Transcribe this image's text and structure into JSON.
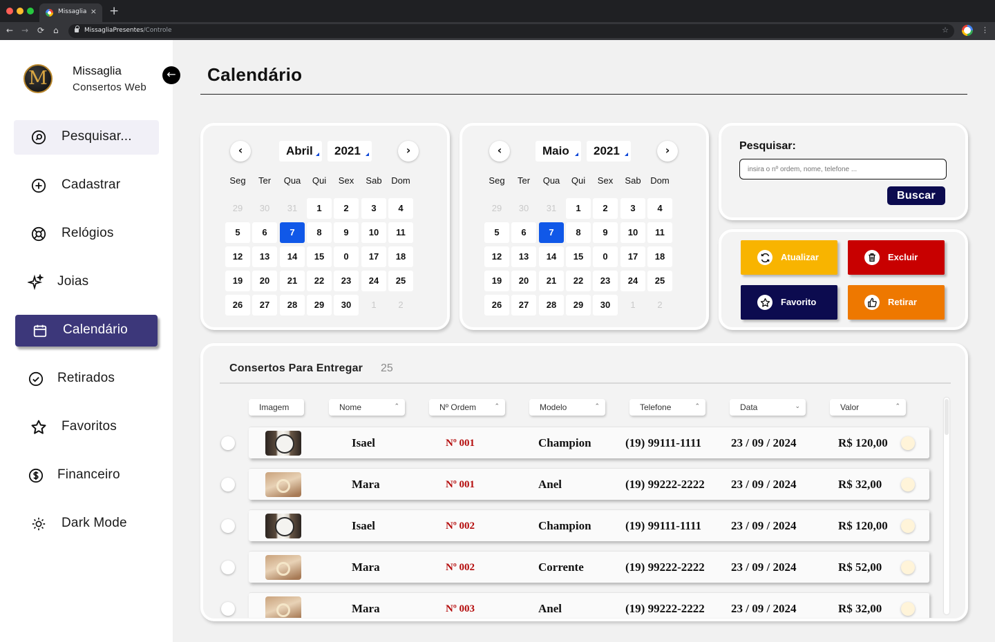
{
  "browser": {
    "tab_title": "Missaglia",
    "tab_close": "×",
    "new_tab": "+",
    "url_domain": "MissagliaPresentes",
    "url_path": "/Controle",
    "nav": {
      "back": "←",
      "forward": "→",
      "reload": "⟳",
      "home": "⌂"
    },
    "bookmark_icon": "☆",
    "menu_icon": "⋮"
  },
  "sidebar": {
    "logo_letter": "M",
    "brand": "Missaglia",
    "brand_sub": "Consertos Web",
    "collapse_icon": "←",
    "items": [
      {
        "label": "Pesquisar...",
        "icon": "search-icon"
      },
      {
        "label": "Cadastrar",
        "icon": "plus-circle-icon"
      },
      {
        "label": "Relógios",
        "icon": "watch-icon"
      },
      {
        "label": "Joias",
        "icon": "sparkles-icon"
      },
      {
        "label": "Calendário",
        "icon": "calendar-icon"
      },
      {
        "label": "Retirados",
        "icon": "check-circle-icon"
      },
      {
        "label": "Favoritos",
        "icon": "star-icon"
      },
      {
        "label": "Financeiro",
        "icon": "dollar-circle-icon"
      },
      {
        "label": "Dark Mode",
        "icon": "sun-icon"
      }
    ],
    "active_item": "Calendário"
  },
  "page": {
    "title": "Calendário"
  },
  "calendars": [
    {
      "month": "Abril",
      "year": "2021",
      "prev": "‹",
      "next": "›",
      "weekdays": [
        "Seg",
        "Ter",
        "Qua",
        "Qui",
        "Sex",
        "Sab",
        "Dom"
      ],
      "days": [
        "29",
        "30",
        "31",
        "1",
        "2",
        "3",
        "4",
        "5",
        "6",
        "7",
        "8",
        "9",
        "10",
        "11",
        "12",
        "13",
        "14",
        "15",
        "0",
        "17",
        "18",
        "19",
        "20",
        "21",
        "22",
        "23",
        "24",
        "25",
        "26",
        "27",
        "28",
        "29",
        "30",
        "1",
        "2"
      ],
      "muted": [
        0,
        1,
        2,
        33,
        34
      ],
      "selected": 9
    },
    {
      "month": "Maio",
      "year": "2021",
      "prev": "‹",
      "next": "›",
      "weekdays": [
        "Seg",
        "Ter",
        "Qua",
        "Qui",
        "Sex",
        "Sab",
        "Dom"
      ],
      "days": [
        "29",
        "30",
        "31",
        "1",
        "2",
        "3",
        "4",
        "5",
        "6",
        "7",
        "8",
        "9",
        "10",
        "11",
        "12",
        "13",
        "14",
        "15",
        "0",
        "17",
        "18",
        "19",
        "20",
        "21",
        "22",
        "23",
        "24",
        "25",
        "26",
        "27",
        "28",
        "29",
        "30",
        "1",
        "2"
      ],
      "muted": [
        0,
        1,
        2,
        33,
        34
      ],
      "selected": 9
    }
  ],
  "search": {
    "label": "Pesquisar:",
    "placeholder": "insira o nº ordem, nome, telefone ...",
    "button": "Buscar"
  },
  "actions": [
    {
      "label": "Atualizar",
      "icon": "refresh-icon",
      "color": "#f8b400"
    },
    {
      "label": "Excluir",
      "icon": "trash-icon",
      "color": "#c80000"
    },
    {
      "label": "Favorito",
      "icon": "star-icon",
      "color": "#0c0b4f"
    },
    {
      "label": "Retirar",
      "icon": "thumbs-up-icon",
      "color": "#ee7800"
    }
  ],
  "list": {
    "title": "Consertos Para Entregar",
    "count": "25",
    "columns": [
      {
        "label": "Imagem",
        "sort": ""
      },
      {
        "label": "Nome",
        "sort": "⌃"
      },
      {
        "label": "Nº Ordem",
        "sort": "⌃"
      },
      {
        "label": "Modelo",
        "sort": "⌃"
      },
      {
        "label": "Telefone",
        "sort": "⌃"
      },
      {
        "label": "Data",
        "sort": "⌄"
      },
      {
        "label": "Valor",
        "sort": "⌃"
      }
    ],
    "rows": [
      {
        "image": "watch",
        "nome": "Isael",
        "ordem": "Nº 001",
        "modelo": "Champion",
        "telefone": "(19) 99111-1111",
        "data": "23 / 09 / 2024",
        "valor": "R$ 120,00"
      },
      {
        "image": "ring",
        "nome": "Mara",
        "ordem": "Nº 001",
        "modelo": "Anel",
        "telefone": "(19) 99222-2222",
        "data": "23 / 09 / 2024",
        "valor": "R$ 32,00"
      },
      {
        "image": "watch",
        "nome": "Isael",
        "ordem": "Nº 002",
        "modelo": "Champion",
        "telefone": "(19) 99111-1111",
        "data": "23 / 09 / 2024",
        "valor": "R$ 120,00"
      },
      {
        "image": "ring",
        "nome": "Mara",
        "ordem": "Nº 002",
        "modelo": "Corrente",
        "telefone": "(19) 99222-2222",
        "data": "23 / 09 / 2024",
        "valor": "R$ 52,00"
      },
      {
        "image": "ring",
        "nome": "Mara",
        "ordem": "Nº 003",
        "modelo": "Anel",
        "telefone": "(19) 99222-2222",
        "data": "23 / 09 / 2024",
        "valor": "R$ 32,00"
      }
    ]
  },
  "colors": {
    "accent": "#3c377a",
    "selected_day": "#1058e8",
    "order_red": "#b40c0c",
    "search_button": "#0c0b4f"
  }
}
